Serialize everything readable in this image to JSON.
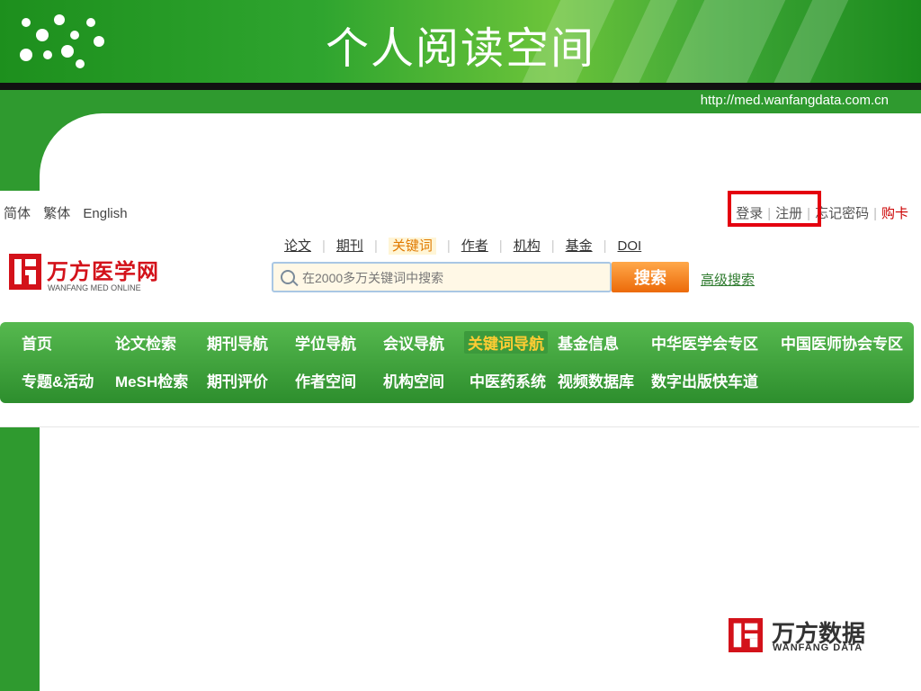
{
  "slide": {
    "title": "个人阅读空间",
    "url": "http://med.wanfangdata.com.cn"
  },
  "site": {
    "lang_links": [
      "简体",
      "繁体",
      "English"
    ],
    "top_links": {
      "login": "登录",
      "register": "注册",
      "forgot_password": "忘记密码",
      "buy_card": "购卡"
    },
    "logo": {
      "name": "万方医学网",
      "subtitle": "WANFANG MED ONLINE"
    },
    "search": {
      "tabs": [
        {
          "label": "论文",
          "active": false
        },
        {
          "label": "期刊",
          "active": false
        },
        {
          "label": "关键词",
          "active": true
        },
        {
          "label": "作者",
          "active": false
        },
        {
          "label": "机构",
          "active": false
        },
        {
          "label": "基金",
          "active": false
        },
        {
          "label": "DOI",
          "active": false
        }
      ],
      "placeholder": "在2000多万关键词中搜索",
      "button": "搜索",
      "advanced": "高级搜索"
    },
    "nav": {
      "row1": [
        "首页",
        "论文检索",
        "期刊导航",
        "学位导航",
        "会议导航",
        "关键词导航",
        "基金信息",
        "中华医学会专区",
        "中国医师协会专区"
      ],
      "row2": [
        "专题&活动",
        "MeSH检索",
        "期刊评价",
        "作者空间",
        "机构空间",
        "中医药系统",
        "视频数据库",
        "数字出版快车道"
      ],
      "active": "关键词导航"
    }
  },
  "footer_logo": {
    "name": "万方数据",
    "subtitle": "WANFANG DATA"
  },
  "colors": {
    "brand_red": "#d3121a",
    "nav_green": "#2d8e2d",
    "accent_orange": "#ec6a09",
    "highlight_red_box": "#e4000f"
  }
}
